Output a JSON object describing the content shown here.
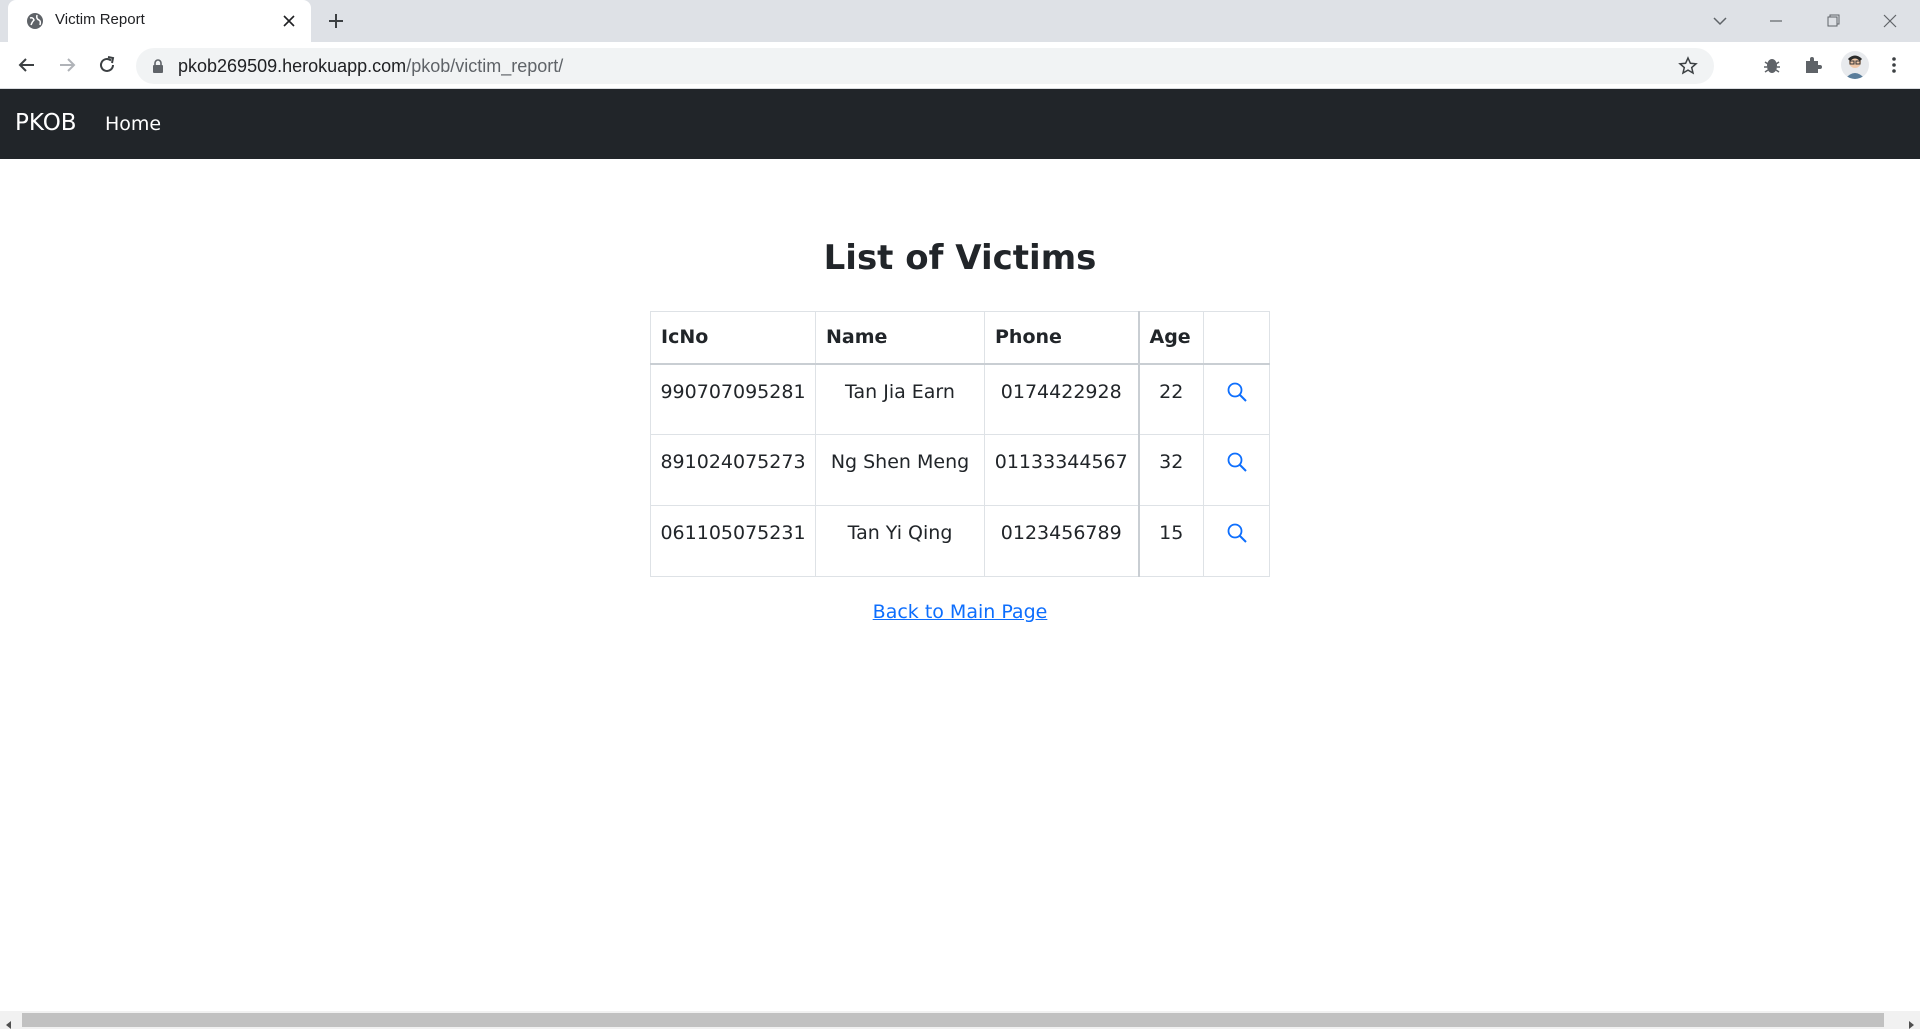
{
  "browser": {
    "tab_title": "Victim Report",
    "url_host": "pkob269509.herokuapp.com",
    "url_path": "/pkob/victim_report/"
  },
  "navbar": {
    "brand": "PKOB",
    "home": "Home"
  },
  "main": {
    "title": "List of Victims",
    "table": {
      "headers": [
        "IcNo",
        "Name",
        "Phone",
        "Age",
        ""
      ],
      "rows": [
        {
          "icno": "990707095281",
          "name": "Tan Jia Earn",
          "phone": "0174422928",
          "age": "22"
        },
        {
          "icno": "891024075273",
          "name": "Ng Shen Meng",
          "phone": "01133344567",
          "age": "32"
        },
        {
          "icno": "061105075231",
          "name": "Tan Yi Qing",
          "phone": "0123456789",
          "age": "15"
        }
      ]
    },
    "back_link": "Back to Main Page"
  },
  "colors": {
    "navbar_bg": "#212529",
    "link": "#0d6efd",
    "tabstrip": "#dee1e6"
  },
  "icons": [
    "globe-icon",
    "close-icon",
    "plus-icon",
    "back-arrow-icon",
    "forward-arrow-icon",
    "reload-icon",
    "lock-icon",
    "star-icon",
    "bug-icon",
    "puzzle-icon",
    "kebab-menu-icon",
    "search-icon"
  ]
}
